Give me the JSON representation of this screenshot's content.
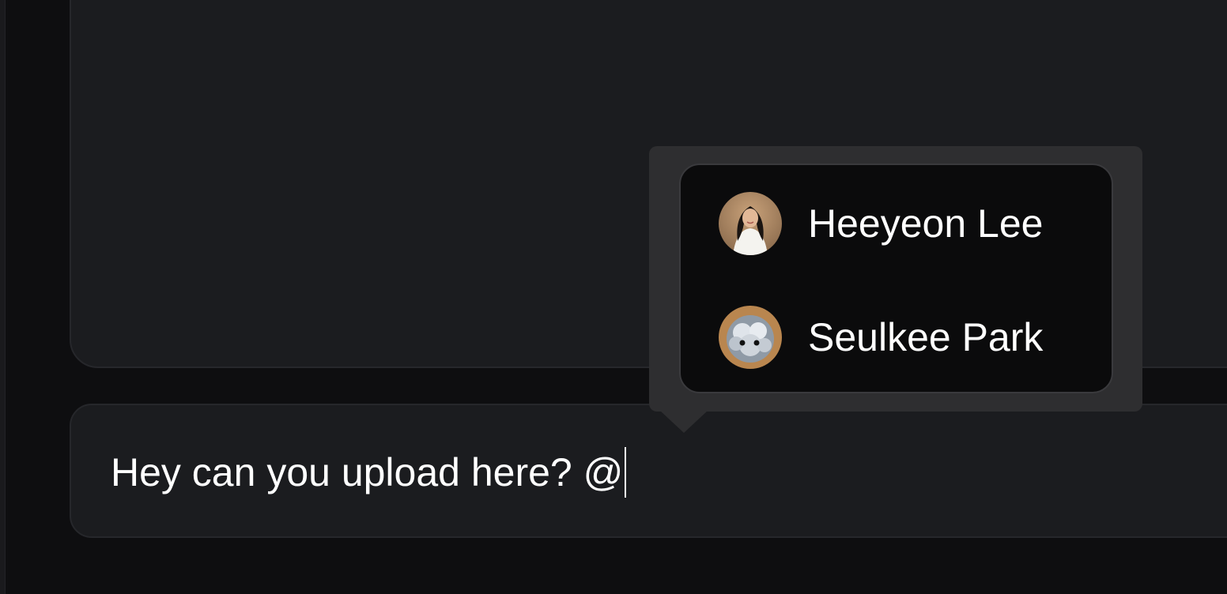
{
  "composer": {
    "value": "Hey can you upload here? @"
  },
  "mention_popover": {
    "users": [
      {
        "name": "Heeyeon Lee",
        "avatar": "person-photo"
      },
      {
        "name": "Seulkee Park",
        "avatar": "fluffy-creature-photo"
      }
    ]
  },
  "colors": {
    "background": "#0e0e10",
    "panel": "#1b1c1f",
    "popover_frame": "#2e2e30",
    "list_background": "#0b0b0c",
    "text": "#ffffff"
  }
}
